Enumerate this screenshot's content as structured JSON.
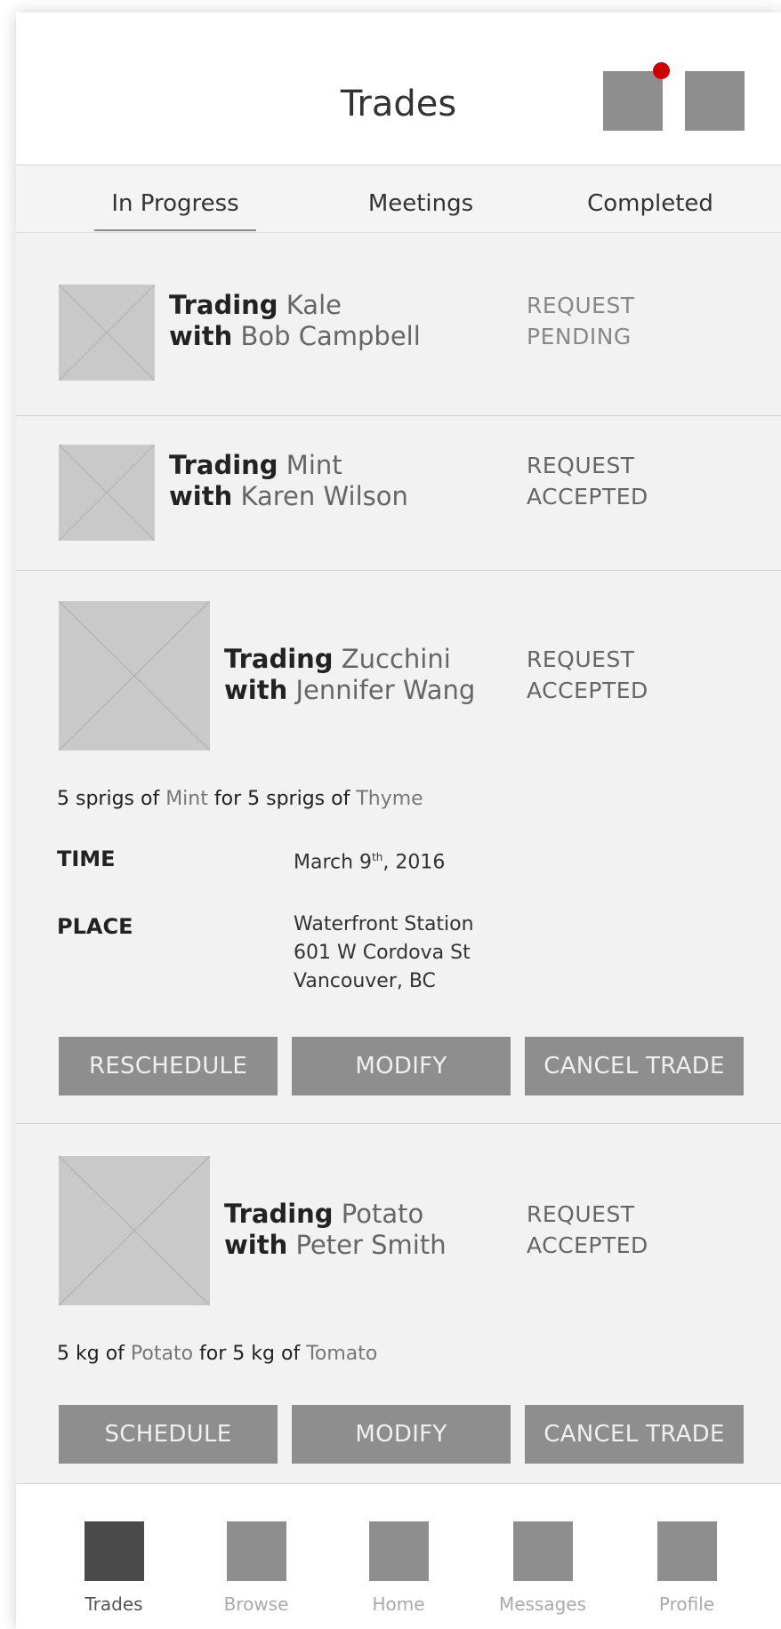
{
  "header": {
    "title": "Trades"
  },
  "tabs": [
    {
      "label": "In Progress",
      "active": true
    },
    {
      "label": "Meetings",
      "active": false
    },
    {
      "label": "Completed",
      "active": false
    }
  ],
  "trades": [
    {
      "trading_label": "Trading",
      "item": "Kale",
      "with_label": "with",
      "partner": "Bob Campbell",
      "status_line1": "REQUEST",
      "status_line2": "PENDING"
    },
    {
      "trading_label": "Trading",
      "item": "Mint",
      "with_label": "with",
      "partner": "Karen Wilson",
      "status_line1": "REQUEST",
      "status_line2": "ACCEPTED"
    },
    {
      "trading_label": "Trading",
      "item": "Zucchini",
      "with_label": "with",
      "partner": "Jennifer Wang",
      "status_line1": "REQUEST",
      "status_line2": "ACCEPTED",
      "summary": {
        "part1": "5 sprigs of",
        "item1": "Mint",
        "part2": "for 5 sprigs of",
        "item2": "Thyme"
      },
      "time_label": "TIME",
      "time_value": "March 9",
      "time_suffix": "th",
      "time_year": ", 2016",
      "place_label": "PLACE",
      "place_line1": "Waterfront Station",
      "place_line2": "601 W Cordova St",
      "place_line3": "Vancouver, BC",
      "buttons": [
        "RESCHEDULE",
        "MODIFY",
        "CANCEL TRADE"
      ]
    },
    {
      "trading_label": "Trading",
      "item": "Potato",
      "with_label": "with",
      "partner": "Peter Smith",
      "status_line1": "REQUEST",
      "status_line2": "ACCEPTED",
      "summary": {
        "part1": "5 kg of",
        "item1": "Potato",
        "part2": "for 5 kg of",
        "item2": "Tomato"
      },
      "buttons": [
        "SCHEDULE",
        "MODIFY",
        "CANCEL TRADE"
      ]
    }
  ],
  "bottom_nav": [
    {
      "label": "Trades",
      "active": true
    },
    {
      "label": "Browse",
      "active": false
    },
    {
      "label": "Home",
      "active": false
    },
    {
      "label": "Messages",
      "active": false
    },
    {
      "label": "Profile",
      "active": false
    }
  ],
  "colors": {
    "notification": "#cc0000",
    "button": "#8e8e8e",
    "active_nav": "#4a4a4a"
  }
}
